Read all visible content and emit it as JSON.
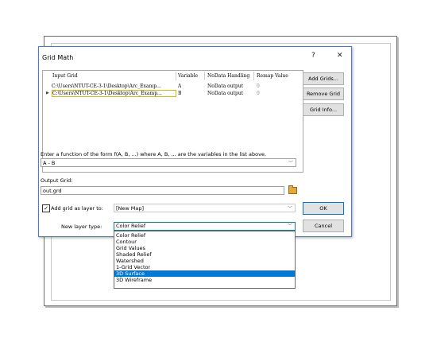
{
  "dialog": {
    "title": "Grid Math",
    "help_label": "?",
    "close_label": "✕"
  },
  "table": {
    "headers": [
      "Input Grid",
      "Variable",
      "NoData Handling",
      "Remap Value"
    ],
    "rows": [
      {
        "path": "C:\\Users\\NTUT-CE-3-1\\Desktop\\Arc_Examp...",
        "variable": "A",
        "nodata": "NoData output",
        "remap": "0",
        "selected": false
      },
      {
        "path": "C:\\Users\\NTUT-CE-3-1\\Desktop\\Arc_Examp...",
        "variable": "B",
        "nodata": "NoData output",
        "remap": "0",
        "selected": true
      }
    ]
  },
  "side_buttons": {
    "add": "Add Grids...",
    "remove": "Remove Grid",
    "info": "Grid Info..."
  },
  "function": {
    "prompt": "Enter a function of the form f(A, B, ...) where A, B, ... are the variables in the list above.",
    "value": "A - B"
  },
  "output": {
    "label": "Output Grid:",
    "value": "out.grd"
  },
  "add_layer": {
    "checked": "✓",
    "label": "Add grid as layer to:",
    "value": "[New Map]"
  },
  "layer_type": {
    "label": "New layer type:",
    "value": "Color Relief",
    "options": [
      "Color Relief",
      "Contour",
      "Grid Values",
      "Shaded Relief",
      "Watershed",
      "1-Grid Vector",
      "3D Surface",
      "3D Wireframe"
    ],
    "highlighted_index": 6
  },
  "buttons": {
    "ok": "OK",
    "cancel": "Cancel"
  },
  "colors": {
    "accent": "#0078d7",
    "selection_border": "#f0b000",
    "button_face": "#e1e1e1"
  }
}
